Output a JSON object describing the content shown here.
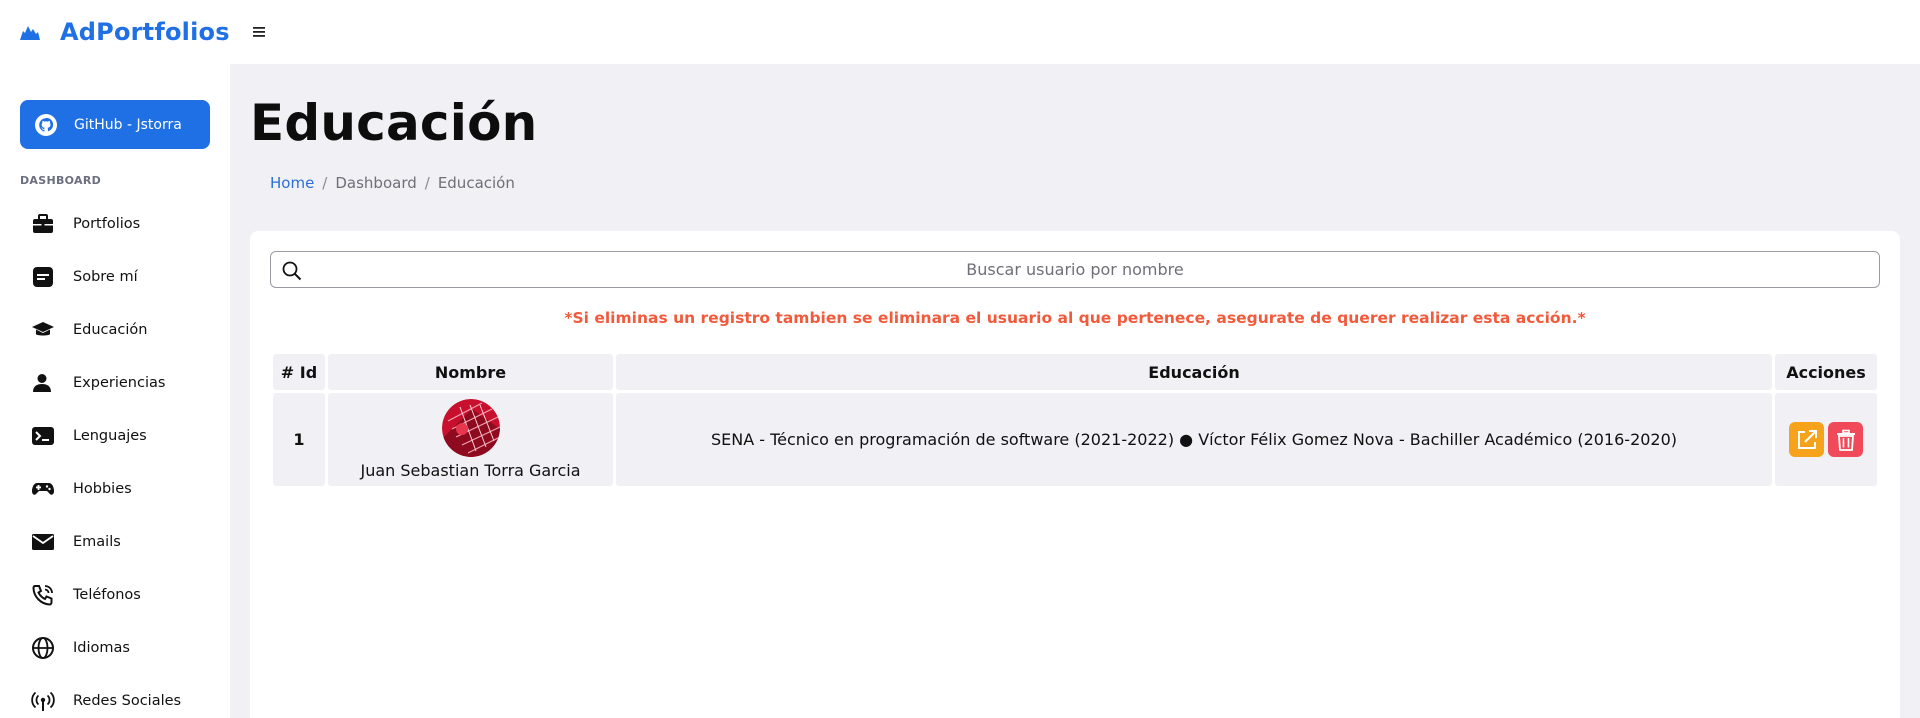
{
  "app": {
    "name": "AdPortfolios"
  },
  "sidebar": {
    "github_label": "GitHub - Jstorra",
    "section_label": "DASHBOARD",
    "items": [
      {
        "label": "Portfolios",
        "icon": "briefcase-icon"
      },
      {
        "label": "Sobre mí",
        "icon": "note-icon"
      },
      {
        "label": "Educación",
        "icon": "graduation-cap-icon"
      },
      {
        "label": "Experiencias",
        "icon": "user-icon"
      },
      {
        "label": "Lenguajes",
        "icon": "terminal-icon"
      },
      {
        "label": "Hobbies",
        "icon": "gamepad-icon"
      },
      {
        "label": "Emails",
        "icon": "envelope-icon"
      },
      {
        "label": "Teléfonos",
        "icon": "phone-icon"
      },
      {
        "label": "Idiomas",
        "icon": "globe-icon"
      },
      {
        "label": "Redes Sociales",
        "icon": "broadcast-icon"
      }
    ]
  },
  "page": {
    "title": "Educación",
    "breadcrumb": [
      "Home",
      "Dashboard",
      "Educación"
    ]
  },
  "search": {
    "placeholder": "Buscar usuario por nombre",
    "value": ""
  },
  "warning": "*Si eliminas un registro tambien se eliminara el usuario al que pertenece, asegurate de querer realizar esta acción.*",
  "table": {
    "headers": [
      "# Id",
      "Nombre",
      "Educación",
      "Acciones"
    ],
    "rows": [
      {
        "id": "1",
        "name": "Juan Sebastian Torra Garcia",
        "education": "SENA - Técnico en programación de software (2021-2022) ● Víctor Félix Gomez Nova - Bachiller Académico (2016-2020)"
      }
    ]
  },
  "colors": {
    "primary": "#1f6fe5",
    "warning_text": "#f25a3c",
    "edit_button": "#f7a21b",
    "delete_button": "#f04a5a",
    "main_bg": "#f0f0f5"
  }
}
